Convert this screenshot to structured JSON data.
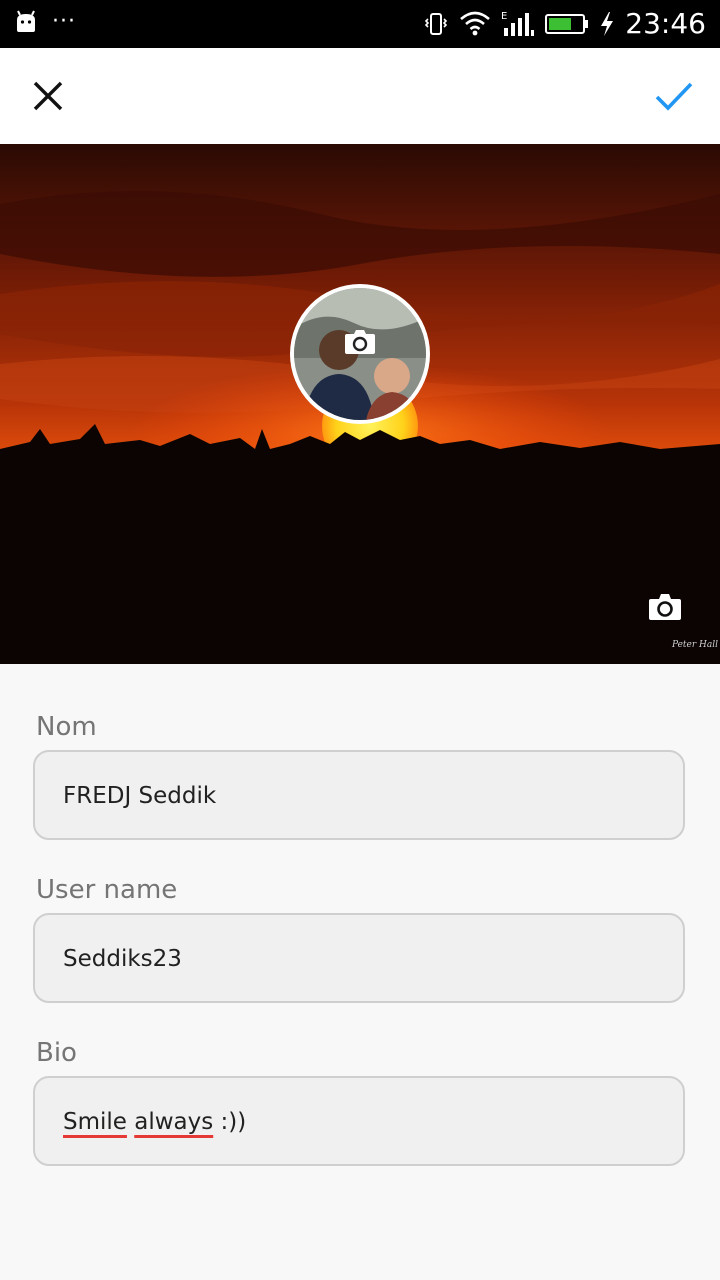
{
  "status_bar": {
    "time": "23:46",
    "icons": [
      "android-icon",
      "more-dots-icon",
      "vibrate-icon",
      "wifi-icon",
      "signal-icon",
      "battery-icon",
      "charging-icon"
    ],
    "dots": "···",
    "network_type": "E"
  },
  "toolbar": {
    "close_icon": "close-icon",
    "confirm_icon": "check-icon",
    "accent_color": "#2196F3"
  },
  "cover": {
    "avatar_camera_icon": "camera-icon",
    "cover_camera_icon": "camera-icon",
    "watermark": "Peter Hall"
  },
  "form": {
    "fields": [
      {
        "label": "Nom",
        "value": "FREDJ Seddik"
      },
      {
        "label": "User name",
        "value": "Seddiks23"
      },
      {
        "label": "Bio",
        "value_parts": [
          "Smile",
          "always",
          ":))"
        ]
      }
    ]
  }
}
